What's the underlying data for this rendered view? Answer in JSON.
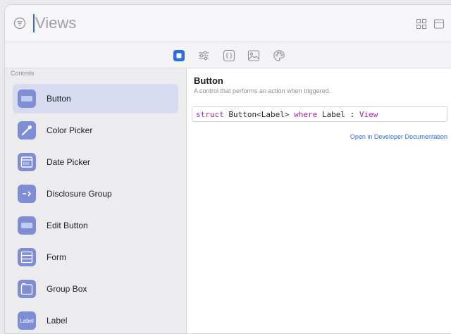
{
  "search": {
    "placeholder": "Views",
    "value": ""
  },
  "library_tabs": [
    {
      "name": "views",
      "icon": "square-icon",
      "selected": true
    },
    {
      "name": "modifiers",
      "icon": "sliders-icon",
      "selected": false
    },
    {
      "name": "snippets",
      "icon": "braces-icon",
      "selected": false
    },
    {
      "name": "images",
      "icon": "photo-icon",
      "selected": false
    },
    {
      "name": "colors",
      "icon": "palette-icon",
      "selected": false
    }
  ],
  "sidebar": {
    "section_header": "Controls",
    "items": [
      {
        "label": "Button",
        "icon": "button-icon",
        "icon_text": "Button",
        "selected": true
      },
      {
        "label": "Color Picker",
        "icon": "eyedropper-icon",
        "selected": false
      },
      {
        "label": "Date Picker",
        "icon": "calendar-icon",
        "selected": false
      },
      {
        "label": "Disclosure Group",
        "icon": "disclosure-group-icon",
        "selected": false
      },
      {
        "label": "Edit Button",
        "icon": "edit-button-icon",
        "icon_text": "Edit",
        "selected": false
      },
      {
        "label": "Form",
        "icon": "form-icon",
        "selected": false
      },
      {
        "label": "Group Box",
        "icon": "group-box-icon",
        "icon_text": "Title",
        "selected": false
      },
      {
        "label": "Label",
        "icon": "label-icon",
        "icon_text": "Label",
        "selected": false
      }
    ]
  },
  "detail": {
    "title": "Button",
    "subtitle": "A control that performs an action when triggered.",
    "declaration": {
      "kw1": "struct",
      "part1": " Button<Label> ",
      "kw2": "where",
      "part2": " Label : ",
      "kw3": "View"
    },
    "link": "Open in Developer Documentation"
  },
  "colors": {
    "accent": "#2f6ee0",
    "icon_tile": "#7f8dd4",
    "selection": "#d7dbf0",
    "keyword": "#a626a4"
  }
}
